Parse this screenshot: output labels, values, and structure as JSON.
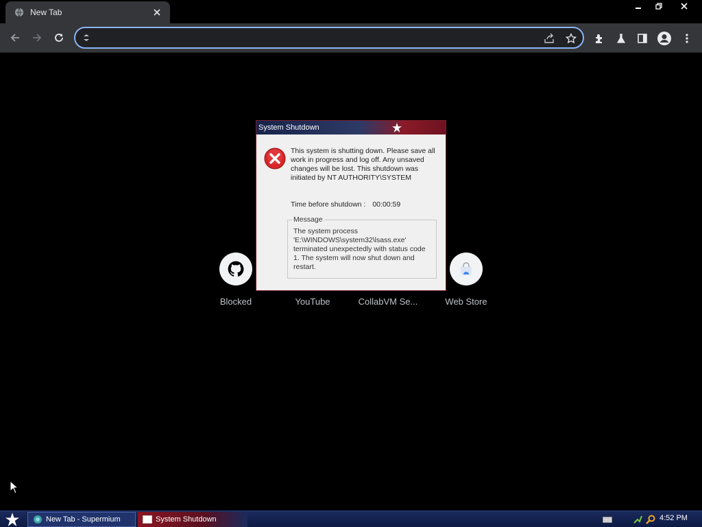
{
  "browser": {
    "tab": {
      "title": "New Tab"
    },
    "omnibox": {
      "value": "",
      "placeholder": ""
    }
  },
  "shortcuts": [
    {
      "label": "Blocked",
      "icon": "github-icon"
    },
    {
      "label": "YouTube",
      "icon": "youtube-icon"
    },
    {
      "label": "CollabVM Se...",
      "icon": "collabvm-icon"
    },
    {
      "label": "Web Store",
      "icon": "web-store-icon"
    }
  ],
  "dialog": {
    "title": "System Shutdown",
    "text": "This system is shutting down. Please save all work in progress and log off. Any unsaved changes will be lost. This shutdown was initiated by NT AUTHORITY\\SYSTEM",
    "countdown_label": "Time before shutdown :",
    "countdown_value": "00:00:59",
    "message_legend": "Message",
    "message_text": "The system process 'E:\\WINDOWS\\system32\\lsass.exe' terminated unexpectedly with status code 1.  The system will now shut down and restart."
  },
  "taskbar": {
    "items": [
      {
        "label": "New Tab - Supermium"
      },
      {
        "label": "System Shutdown"
      }
    ],
    "clock": "4:52 PM"
  },
  "colors": {
    "omnibox_focus": "#8ab4f8",
    "dialog_title_start": "#17234a",
    "dialog_title_end": "#8a1a28",
    "error_red": "#d9262b",
    "taskbar": "#0d1a44"
  }
}
